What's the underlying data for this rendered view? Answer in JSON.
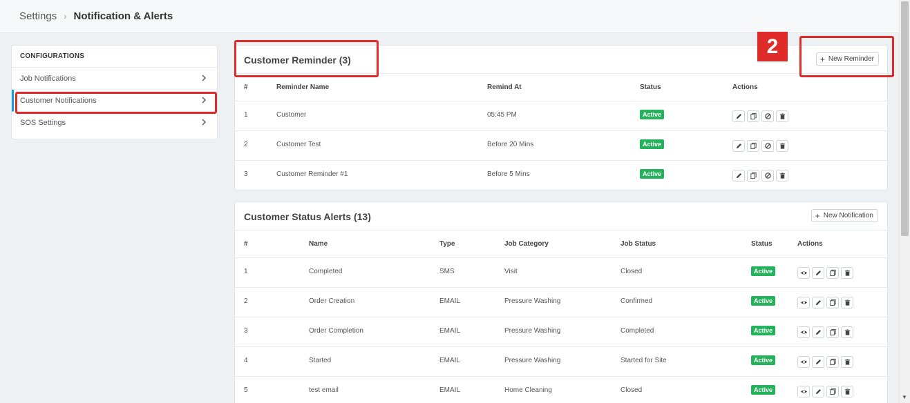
{
  "breadcrumb": {
    "root": "Settings",
    "separator": "›",
    "current": "Notification & Alerts"
  },
  "sidebar": {
    "heading": "CONFIGURATIONS",
    "items": [
      {
        "label": "Job Notifications"
      },
      {
        "label": "Customer Notifications"
      },
      {
        "label": "SOS Settings"
      }
    ]
  },
  "reminders": {
    "title": "Customer Reminder (3)",
    "new_button": "New Reminder",
    "columns": [
      "#",
      "Reminder Name",
      "Remind At",
      "Status",
      "Actions"
    ],
    "rows": [
      {
        "num": "1",
        "name": "Customer",
        "remind_at": "05:45 PM",
        "status": "Active"
      },
      {
        "num": "2",
        "name": "Customer Test",
        "remind_at": "Before 20 Mins",
        "status": "Active"
      },
      {
        "num": "3",
        "name": "Customer Reminder #1",
        "remind_at": "Before 5 Mins",
        "status": "Active"
      }
    ]
  },
  "alerts": {
    "title": "Customer Status Alerts (13)",
    "new_button": "New Notification",
    "columns": [
      "#",
      "Name",
      "Type",
      "Job Category",
      "Job Status",
      "Status",
      "Actions"
    ],
    "rows": [
      {
        "num": "1",
        "name": "Completed",
        "type": "SMS",
        "category": "Visit",
        "job_status": "Closed",
        "status": "Active"
      },
      {
        "num": "2",
        "name": "Order Creation",
        "type": "EMAIL",
        "category": "Pressure Washing",
        "job_status": "Confirmed",
        "status": "Active"
      },
      {
        "num": "3",
        "name": "Order Completion",
        "type": "EMAIL",
        "category": "Pressure Washing",
        "job_status": "Completed",
        "status": "Active"
      },
      {
        "num": "4",
        "name": "Started",
        "type": "EMAIL",
        "category": "Pressure Washing",
        "job_status": "Started for Site",
        "status": "Active"
      },
      {
        "num": "5",
        "name": "test email",
        "type": "EMAIL",
        "category": "Home Cleaning",
        "job_status": "Closed",
        "status": "Active"
      }
    ]
  },
  "annotation": {
    "marker": "2",
    "color": "#e02b2b"
  },
  "colors": {
    "active_badge": "#24b35a",
    "sidebar_active": "#1a9cd8"
  },
  "icons": {
    "reminder_actions": [
      "edit-icon",
      "copy-icon",
      "disable-icon",
      "delete-icon"
    ],
    "alert_actions": [
      "view-icon",
      "edit-icon",
      "copy-icon",
      "delete-icon"
    ]
  }
}
